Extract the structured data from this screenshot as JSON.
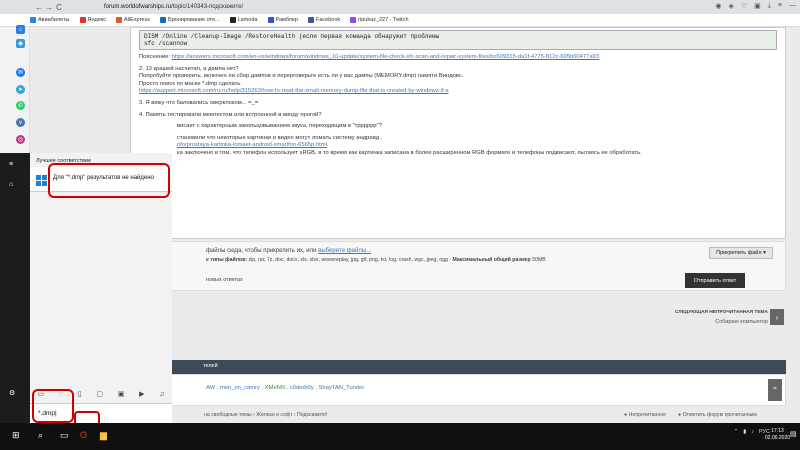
{
  "browser": {
    "url_host": "forum.worldofwarships.ru",
    "url_path": "/topic/140343-подскажите/",
    "nav": {
      "back": "←",
      "forward": "→",
      "reload": "C",
      "home": "⌂"
    },
    "bookmarks": [
      {
        "label": "Авиабилеты",
        "color": "#2b82e8"
      },
      {
        "label": "Яндекс",
        "color": "#e13333"
      },
      {
        "label": "AliExpress",
        "color": "#e85a1c"
      },
      {
        "label": "Бронирование оте...",
        "color": "#1a64c8"
      },
      {
        "label": "Lamoda",
        "color": "#222222"
      },
      {
        "label": "Рамблер",
        "color": "#3355cc"
      },
      {
        "label": "Facebook",
        "color": "#3b5998"
      },
      {
        "label": "ripukaz_227 - Twitch",
        "color": "#8e4cf0"
      }
    ]
  },
  "post": {
    "code_line1": "DISM /Online /Cleanup-Image /RestoreHealth (если первая команда обнаружит проблемы",
    "code_line2": "sfc /scannow",
    "p1_label": "Пояснение:",
    "p1_link": "https://answers.microsoft.com/en-us/windows/forum/windows_10-update/system-file-check-sfc-scan-and-repair-system-files/bc609315-da1f-4775-812c-695b60477a93",
    "p2_l1": "2. 13 крашей насчитал, а дампа нет?",
    "p2_l2": "Попробуйте проверить, включен ли сбор дампов и переproверьте есть ли у вас дампы (MEMORY.dmp) памяти Виндовс.",
    "p2_l3": "Просто поиск по маске *.dmp сделать.",
    "p2_link": "https://support.microsoft.com/ru-ru/help/315263/how-to-read-the-small-memory-dump-file-that-is-created-by-windows-if-a",
    "p3": "3. Я вижу что баловались оверклоком... =_=",
    "p4": "4. Память тестировали мемтестом или встроенной в винду прогой?",
    "p5": "висает с характерным закольцовыванием звука, переходящим в \"трррррр\"?",
    "p6_l1": "становили что некоторые картинки и видео могут ломать систему андроид .",
    "p6_link": "nfo/prostaya-kartinka-lomaet-android-smartfon-6565p.html",
    "p6_l3": "ка заключено в том, что телефон использует sRGB, в то время как картинка записана в более расширенном RGB формате и телефоны подвисают, пытаясь ее обработать."
  },
  "attach": {
    "drop_text": "файлы сюда, чтобы прикрепить их, или",
    "drop_link": "выберите файлы...",
    "types_label": "е типы файлов:",
    "types": "zip, rar, 7z, doc, docx, xls, xlsx, wowsreplay, jpg, gif, png, txt, log, crash, wgc, jpeg, ogg",
    "max_label": "· Максимальный общий размер",
    "max_value": "50MB",
    "attach_button": "Прикрепить файл ▾"
  },
  "reply": {
    "no_new": "новых ответах",
    "send_button": "Отправить ответ"
  },
  "next_topic": {
    "label": "СЛЕДУЮЩАЯ НЕПРОЧИТАННАЯ ТЕМА",
    "title": "Собираю компьютер",
    "arrow": "›"
  },
  "users": {
    "header": "телей",
    "list_a": "AW , men_on_camry , ",
    "list_green": "XMeNN",
    "list_b": " , c0derb0y , ShayTAN_Tunder"
  },
  "footer": {
    "left": "на свободные темы › Железо и софт › Подскажите!",
    "unread": "Непрочитанное",
    "mark": "Отметить форум прочитанным"
  },
  "start_menu": {
    "best_match": "Лучшее соответствие",
    "result": "Для \"*.dmp\" результатов не найдено",
    "search_value": "*.dmp|"
  },
  "clock": {
    "time": "17:13",
    "date": "02.06.2020",
    "lang": "РУС"
  }
}
